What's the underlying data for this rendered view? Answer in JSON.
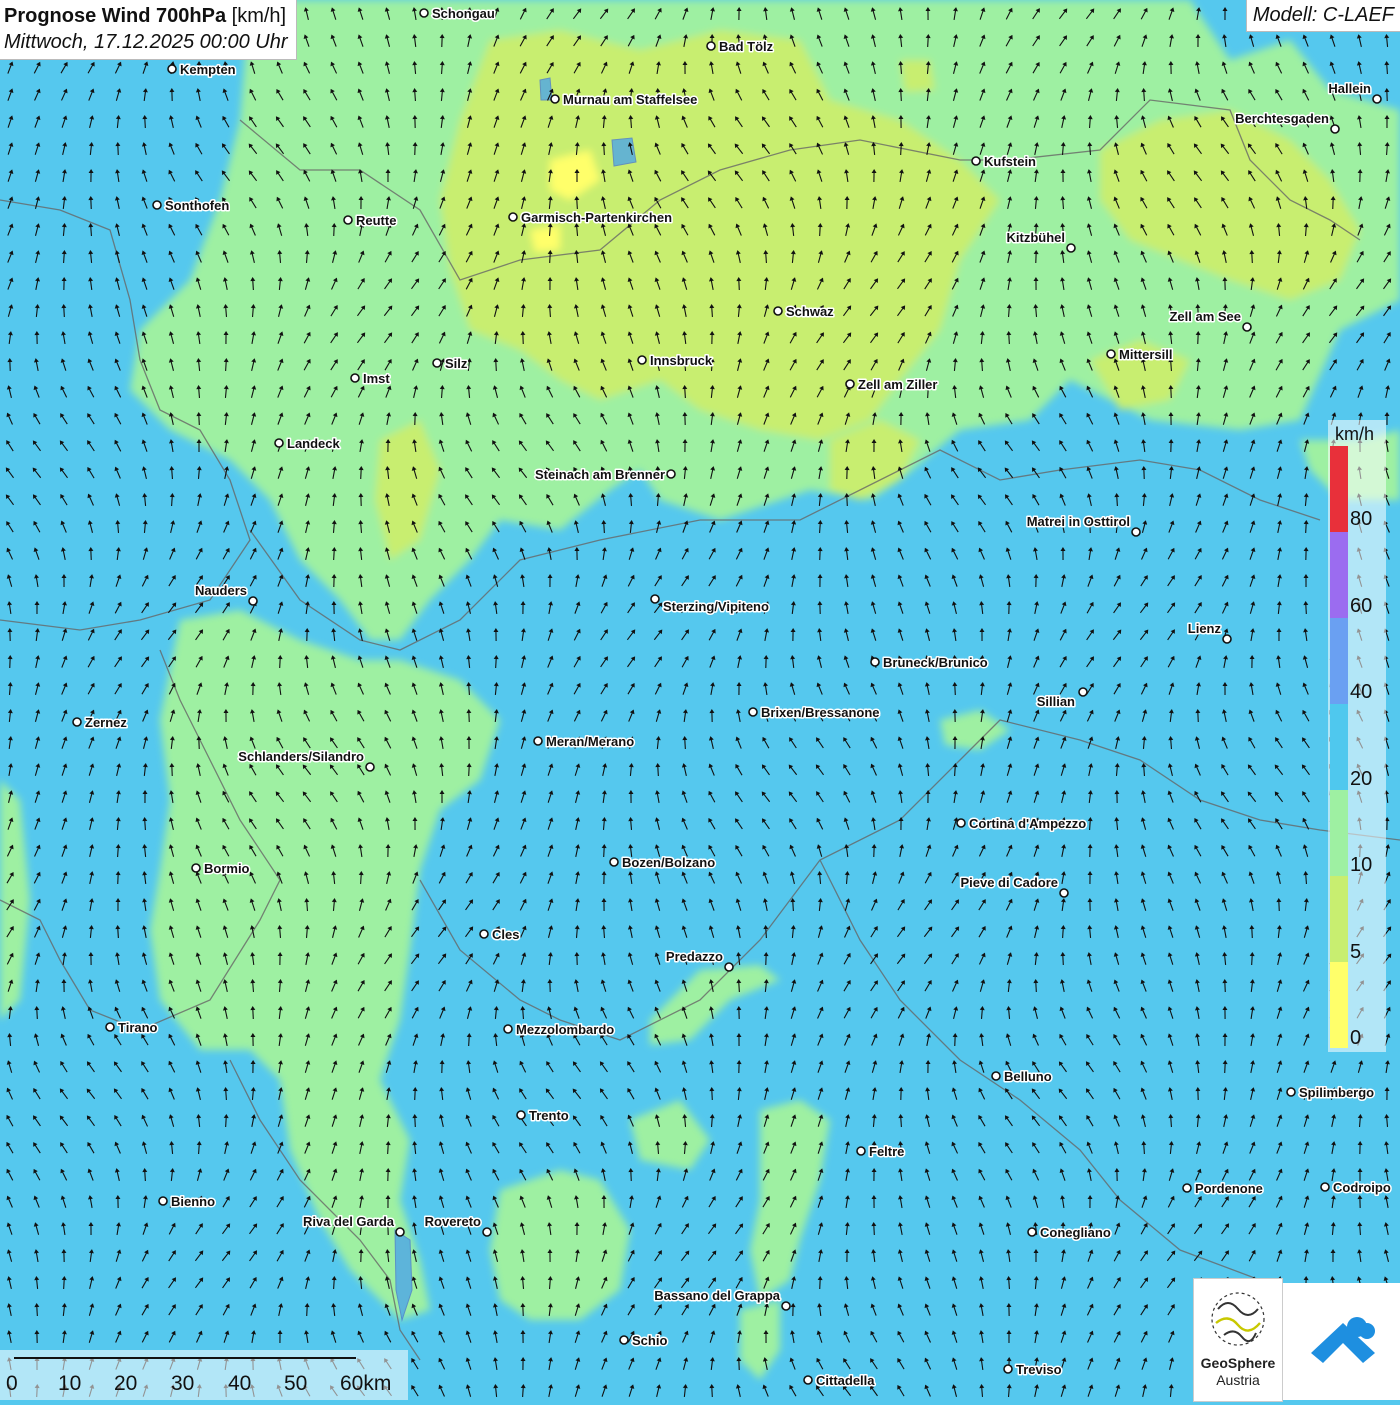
{
  "header": {
    "title_bold": "Prognose Wind 700hPa",
    "title_unit": " [km/h]",
    "date": "Mittwoch, 17.12.2025 00:00 Uhr",
    "model": "Modell: C-LAEF"
  },
  "legend": {
    "unit": "km/h",
    "colors": [
      "#e8303a",
      "#9b6cf0",
      "#6aa0f2",
      "#4fc8ee",
      "#9ef0a2",
      "#c8ee70",
      "#ffff6a"
    ],
    "ticks": [
      "80",
      "60",
      "40",
      "20",
      "10",
      "5",
      "0"
    ]
  },
  "scalebar": {
    "labels": [
      "0",
      "10",
      "20",
      "30",
      "40",
      "50",
      "60km"
    ]
  },
  "logos": {
    "geosphere_line1": "GeoSphere",
    "geosphere_line2": "Austria"
  },
  "cities": [
    {
      "name": "Schongau"
    },
    {
      "name": "Bad Tölz"
    },
    {
      "name": "Kempten"
    },
    {
      "name": "Hallein"
    },
    {
      "name": "Murnau am Staffelsee"
    },
    {
      "name": "Berchtesgaden"
    },
    {
      "name": "Kufstein"
    },
    {
      "name": "Sonthofen"
    },
    {
      "name": "Reutte"
    },
    {
      "name": "Garmisch-Partenkirchen"
    },
    {
      "name": "Kitzbühel"
    },
    {
      "name": "Schwaz"
    },
    {
      "name": "Zell am See"
    },
    {
      "name": "Mittersill"
    },
    {
      "name": "Innsbruck"
    },
    {
      "name": "Silz"
    },
    {
      "name": "Imst"
    },
    {
      "name": "Zell am Ziller"
    },
    {
      "name": "Landeck"
    },
    {
      "name": "Steinach am Brenner"
    },
    {
      "name": "Matrei in Osttirol"
    },
    {
      "name": "Nauders"
    },
    {
      "name": "Sterzing/Vipiteno"
    },
    {
      "name": "Lienz"
    },
    {
      "name": "Bruneck/Brunico"
    },
    {
      "name": "Sillian"
    },
    {
      "name": "Zernez"
    },
    {
      "name": "Brixen/Bressanone"
    },
    {
      "name": "Meran/Merano"
    },
    {
      "name": "Schlanders/Silandro"
    },
    {
      "name": "Cortina d'Ampezzo"
    },
    {
      "name": "Bozen/Bolzano"
    },
    {
      "name": "Bormio"
    },
    {
      "name": "Pieve di Cadore"
    },
    {
      "name": "Cles"
    },
    {
      "name": "Predazzo"
    },
    {
      "name": "Tirano"
    },
    {
      "name": "Mezzolombardo"
    },
    {
      "name": "Belluno"
    },
    {
      "name": "Spilimbergo"
    },
    {
      "name": "Trento"
    },
    {
      "name": "Feltre"
    },
    {
      "name": "Bienno"
    },
    {
      "name": "Pordenone"
    },
    {
      "name": "Codroipo"
    },
    {
      "name": "Riva del Garda"
    },
    {
      "name": "Rovereto"
    },
    {
      "name": "Conegliano"
    },
    {
      "name": "Bassano del Grappa"
    },
    {
      "name": "Schio"
    },
    {
      "name": "Treviso"
    },
    {
      "name": "Cittadella"
    }
  ]
}
